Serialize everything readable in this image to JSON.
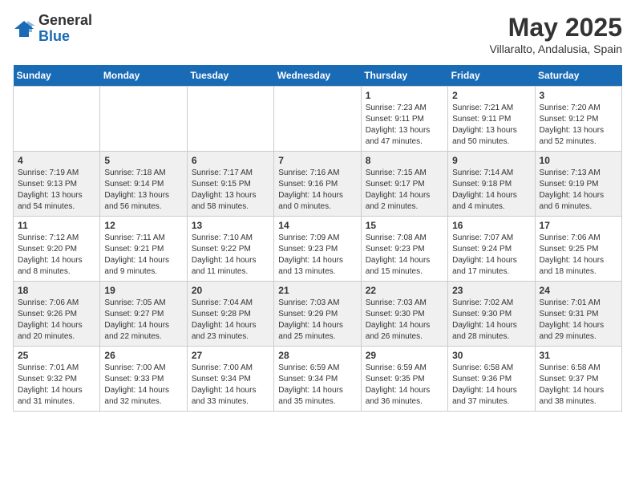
{
  "header": {
    "logo_general": "General",
    "logo_blue": "Blue",
    "month_title": "May 2025",
    "location": "Villaralto, Andalusia, Spain"
  },
  "days_of_week": [
    "Sunday",
    "Monday",
    "Tuesday",
    "Wednesday",
    "Thursday",
    "Friday",
    "Saturday"
  ],
  "weeks": [
    [
      {
        "day": "",
        "info": ""
      },
      {
        "day": "",
        "info": ""
      },
      {
        "day": "",
        "info": ""
      },
      {
        "day": "",
        "info": ""
      },
      {
        "day": "1",
        "info": "Sunrise: 7:23 AM\nSunset: 9:11 PM\nDaylight: 13 hours\nand 47 minutes."
      },
      {
        "day": "2",
        "info": "Sunrise: 7:21 AM\nSunset: 9:11 PM\nDaylight: 13 hours\nand 50 minutes."
      },
      {
        "day": "3",
        "info": "Sunrise: 7:20 AM\nSunset: 9:12 PM\nDaylight: 13 hours\nand 52 minutes."
      }
    ],
    [
      {
        "day": "4",
        "info": "Sunrise: 7:19 AM\nSunset: 9:13 PM\nDaylight: 13 hours\nand 54 minutes."
      },
      {
        "day": "5",
        "info": "Sunrise: 7:18 AM\nSunset: 9:14 PM\nDaylight: 13 hours\nand 56 minutes."
      },
      {
        "day": "6",
        "info": "Sunrise: 7:17 AM\nSunset: 9:15 PM\nDaylight: 13 hours\nand 58 minutes."
      },
      {
        "day": "7",
        "info": "Sunrise: 7:16 AM\nSunset: 9:16 PM\nDaylight: 14 hours\nand 0 minutes."
      },
      {
        "day": "8",
        "info": "Sunrise: 7:15 AM\nSunset: 9:17 PM\nDaylight: 14 hours\nand 2 minutes."
      },
      {
        "day": "9",
        "info": "Sunrise: 7:14 AM\nSunset: 9:18 PM\nDaylight: 14 hours\nand 4 minutes."
      },
      {
        "day": "10",
        "info": "Sunrise: 7:13 AM\nSunset: 9:19 PM\nDaylight: 14 hours\nand 6 minutes."
      }
    ],
    [
      {
        "day": "11",
        "info": "Sunrise: 7:12 AM\nSunset: 9:20 PM\nDaylight: 14 hours\nand 8 minutes."
      },
      {
        "day": "12",
        "info": "Sunrise: 7:11 AM\nSunset: 9:21 PM\nDaylight: 14 hours\nand 9 minutes."
      },
      {
        "day": "13",
        "info": "Sunrise: 7:10 AM\nSunset: 9:22 PM\nDaylight: 14 hours\nand 11 minutes."
      },
      {
        "day": "14",
        "info": "Sunrise: 7:09 AM\nSunset: 9:23 PM\nDaylight: 14 hours\nand 13 minutes."
      },
      {
        "day": "15",
        "info": "Sunrise: 7:08 AM\nSunset: 9:23 PM\nDaylight: 14 hours\nand 15 minutes."
      },
      {
        "day": "16",
        "info": "Sunrise: 7:07 AM\nSunset: 9:24 PM\nDaylight: 14 hours\nand 17 minutes."
      },
      {
        "day": "17",
        "info": "Sunrise: 7:06 AM\nSunset: 9:25 PM\nDaylight: 14 hours\nand 18 minutes."
      }
    ],
    [
      {
        "day": "18",
        "info": "Sunrise: 7:06 AM\nSunset: 9:26 PM\nDaylight: 14 hours\nand 20 minutes."
      },
      {
        "day": "19",
        "info": "Sunrise: 7:05 AM\nSunset: 9:27 PM\nDaylight: 14 hours\nand 22 minutes."
      },
      {
        "day": "20",
        "info": "Sunrise: 7:04 AM\nSunset: 9:28 PM\nDaylight: 14 hours\nand 23 minutes."
      },
      {
        "day": "21",
        "info": "Sunrise: 7:03 AM\nSunset: 9:29 PM\nDaylight: 14 hours\nand 25 minutes."
      },
      {
        "day": "22",
        "info": "Sunrise: 7:03 AM\nSunset: 9:30 PM\nDaylight: 14 hours\nand 26 minutes."
      },
      {
        "day": "23",
        "info": "Sunrise: 7:02 AM\nSunset: 9:30 PM\nDaylight: 14 hours\nand 28 minutes."
      },
      {
        "day": "24",
        "info": "Sunrise: 7:01 AM\nSunset: 9:31 PM\nDaylight: 14 hours\nand 29 minutes."
      }
    ],
    [
      {
        "day": "25",
        "info": "Sunrise: 7:01 AM\nSunset: 9:32 PM\nDaylight: 14 hours\nand 31 minutes."
      },
      {
        "day": "26",
        "info": "Sunrise: 7:00 AM\nSunset: 9:33 PM\nDaylight: 14 hours\nand 32 minutes."
      },
      {
        "day": "27",
        "info": "Sunrise: 7:00 AM\nSunset: 9:34 PM\nDaylight: 14 hours\nand 33 minutes."
      },
      {
        "day": "28",
        "info": "Sunrise: 6:59 AM\nSunset: 9:34 PM\nDaylight: 14 hours\nand 35 minutes."
      },
      {
        "day": "29",
        "info": "Sunrise: 6:59 AM\nSunset: 9:35 PM\nDaylight: 14 hours\nand 36 minutes."
      },
      {
        "day": "30",
        "info": "Sunrise: 6:58 AM\nSunset: 9:36 PM\nDaylight: 14 hours\nand 37 minutes."
      },
      {
        "day": "31",
        "info": "Sunrise: 6:58 AM\nSunset: 9:37 PM\nDaylight: 14 hours\nand 38 minutes."
      }
    ]
  ]
}
